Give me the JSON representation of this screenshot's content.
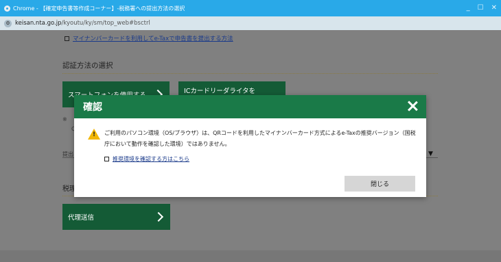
{
  "window": {
    "title": "Chrome - 【確定申告書等作成コーナー】-税務署への提出方法の選択",
    "controls": [
      "_",
      "☐",
      "✕"
    ]
  },
  "urlbar": {
    "domain": "keisan.nta.go.jp",
    "path": "/kyoutu/ky/sm/top_web#bsctrl"
  },
  "page": {
    "top_link": "マイナンバーカードを利用してe-Taxで申告書を提出する方法",
    "auth_heading": "認証方法の選択",
    "btn_smartphone": "スマートフォンを使用する",
    "btn_ic_reader": "ICカードリーダライタを",
    "note_mark": "※",
    "faded_q": "Q",
    "faded_teishutsu": "提出",
    "tax_heading_part": "税理",
    "btn_proxy": "代理送信"
  },
  "modal": {
    "title": "確認",
    "message": "ご利用のパソコン環境（OS/ブラウザ）は、QRコードを利用したマイナンバーカード方式によるe-Taxの推奨バージョン（国税庁において動作を確認した環境）ではありません。",
    "link": "推奨環境を確認する方はこちら",
    "close_button": "閉じる"
  },
  "colors": {
    "header_green": "#1a7a48",
    "button_green": "#145b36",
    "titlebar_blue": "#29a9e8",
    "warning_yellow": "#f2b705"
  }
}
